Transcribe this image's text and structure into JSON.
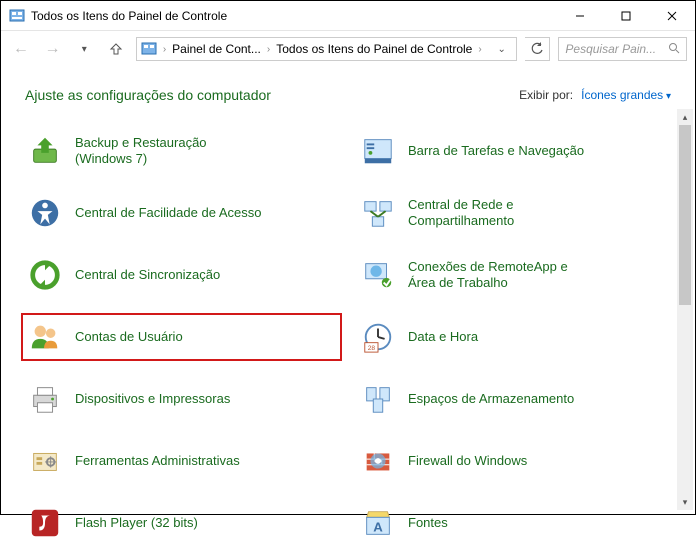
{
  "window": {
    "title": "Todos os Itens do Painel de Controle"
  },
  "breadcrumb": {
    "crumb1": "Painel de Cont...",
    "crumb2": "Todos os Itens do Painel de Controle"
  },
  "search": {
    "placeholder": "Pesquisar Pain..."
  },
  "header": {
    "heading": "Ajuste as configurações do computador",
    "viewby_label": "Exibir por:",
    "viewby_value": "Ícones grandes"
  },
  "items": [
    {
      "label": "Backup e Restauração (Windows 7)",
      "icon": "backup",
      "highlighted": false
    },
    {
      "label": "Barra de Tarefas e Navegação",
      "icon": "taskbar",
      "highlighted": false
    },
    {
      "label": "Central de Facilidade de Acesso",
      "icon": "ease",
      "highlighted": false
    },
    {
      "label": "Central de Rede e Compartilhamento",
      "icon": "network",
      "highlighted": false
    },
    {
      "label": "Central de Sincronização",
      "icon": "sync",
      "highlighted": false
    },
    {
      "label": "Conexões de RemoteApp e Área de Trabalho",
      "icon": "remote",
      "highlighted": false
    },
    {
      "label": "Contas de Usuário",
      "icon": "users",
      "highlighted": true
    },
    {
      "label": "Data e Hora",
      "icon": "clock",
      "highlighted": false
    },
    {
      "label": "Dispositivos e Impressoras",
      "icon": "printer",
      "highlighted": false
    },
    {
      "label": "Espaços de Armazenamento",
      "icon": "storage",
      "highlighted": false
    },
    {
      "label": "Ferramentas Administrativas",
      "icon": "admin",
      "highlighted": false
    },
    {
      "label": "Firewall do Windows",
      "icon": "firewall",
      "highlighted": false
    },
    {
      "label": "Flash Player (32 bits)",
      "icon": "flash",
      "highlighted": false
    },
    {
      "label": "Fontes",
      "icon": "fonts",
      "highlighted": false
    }
  ]
}
